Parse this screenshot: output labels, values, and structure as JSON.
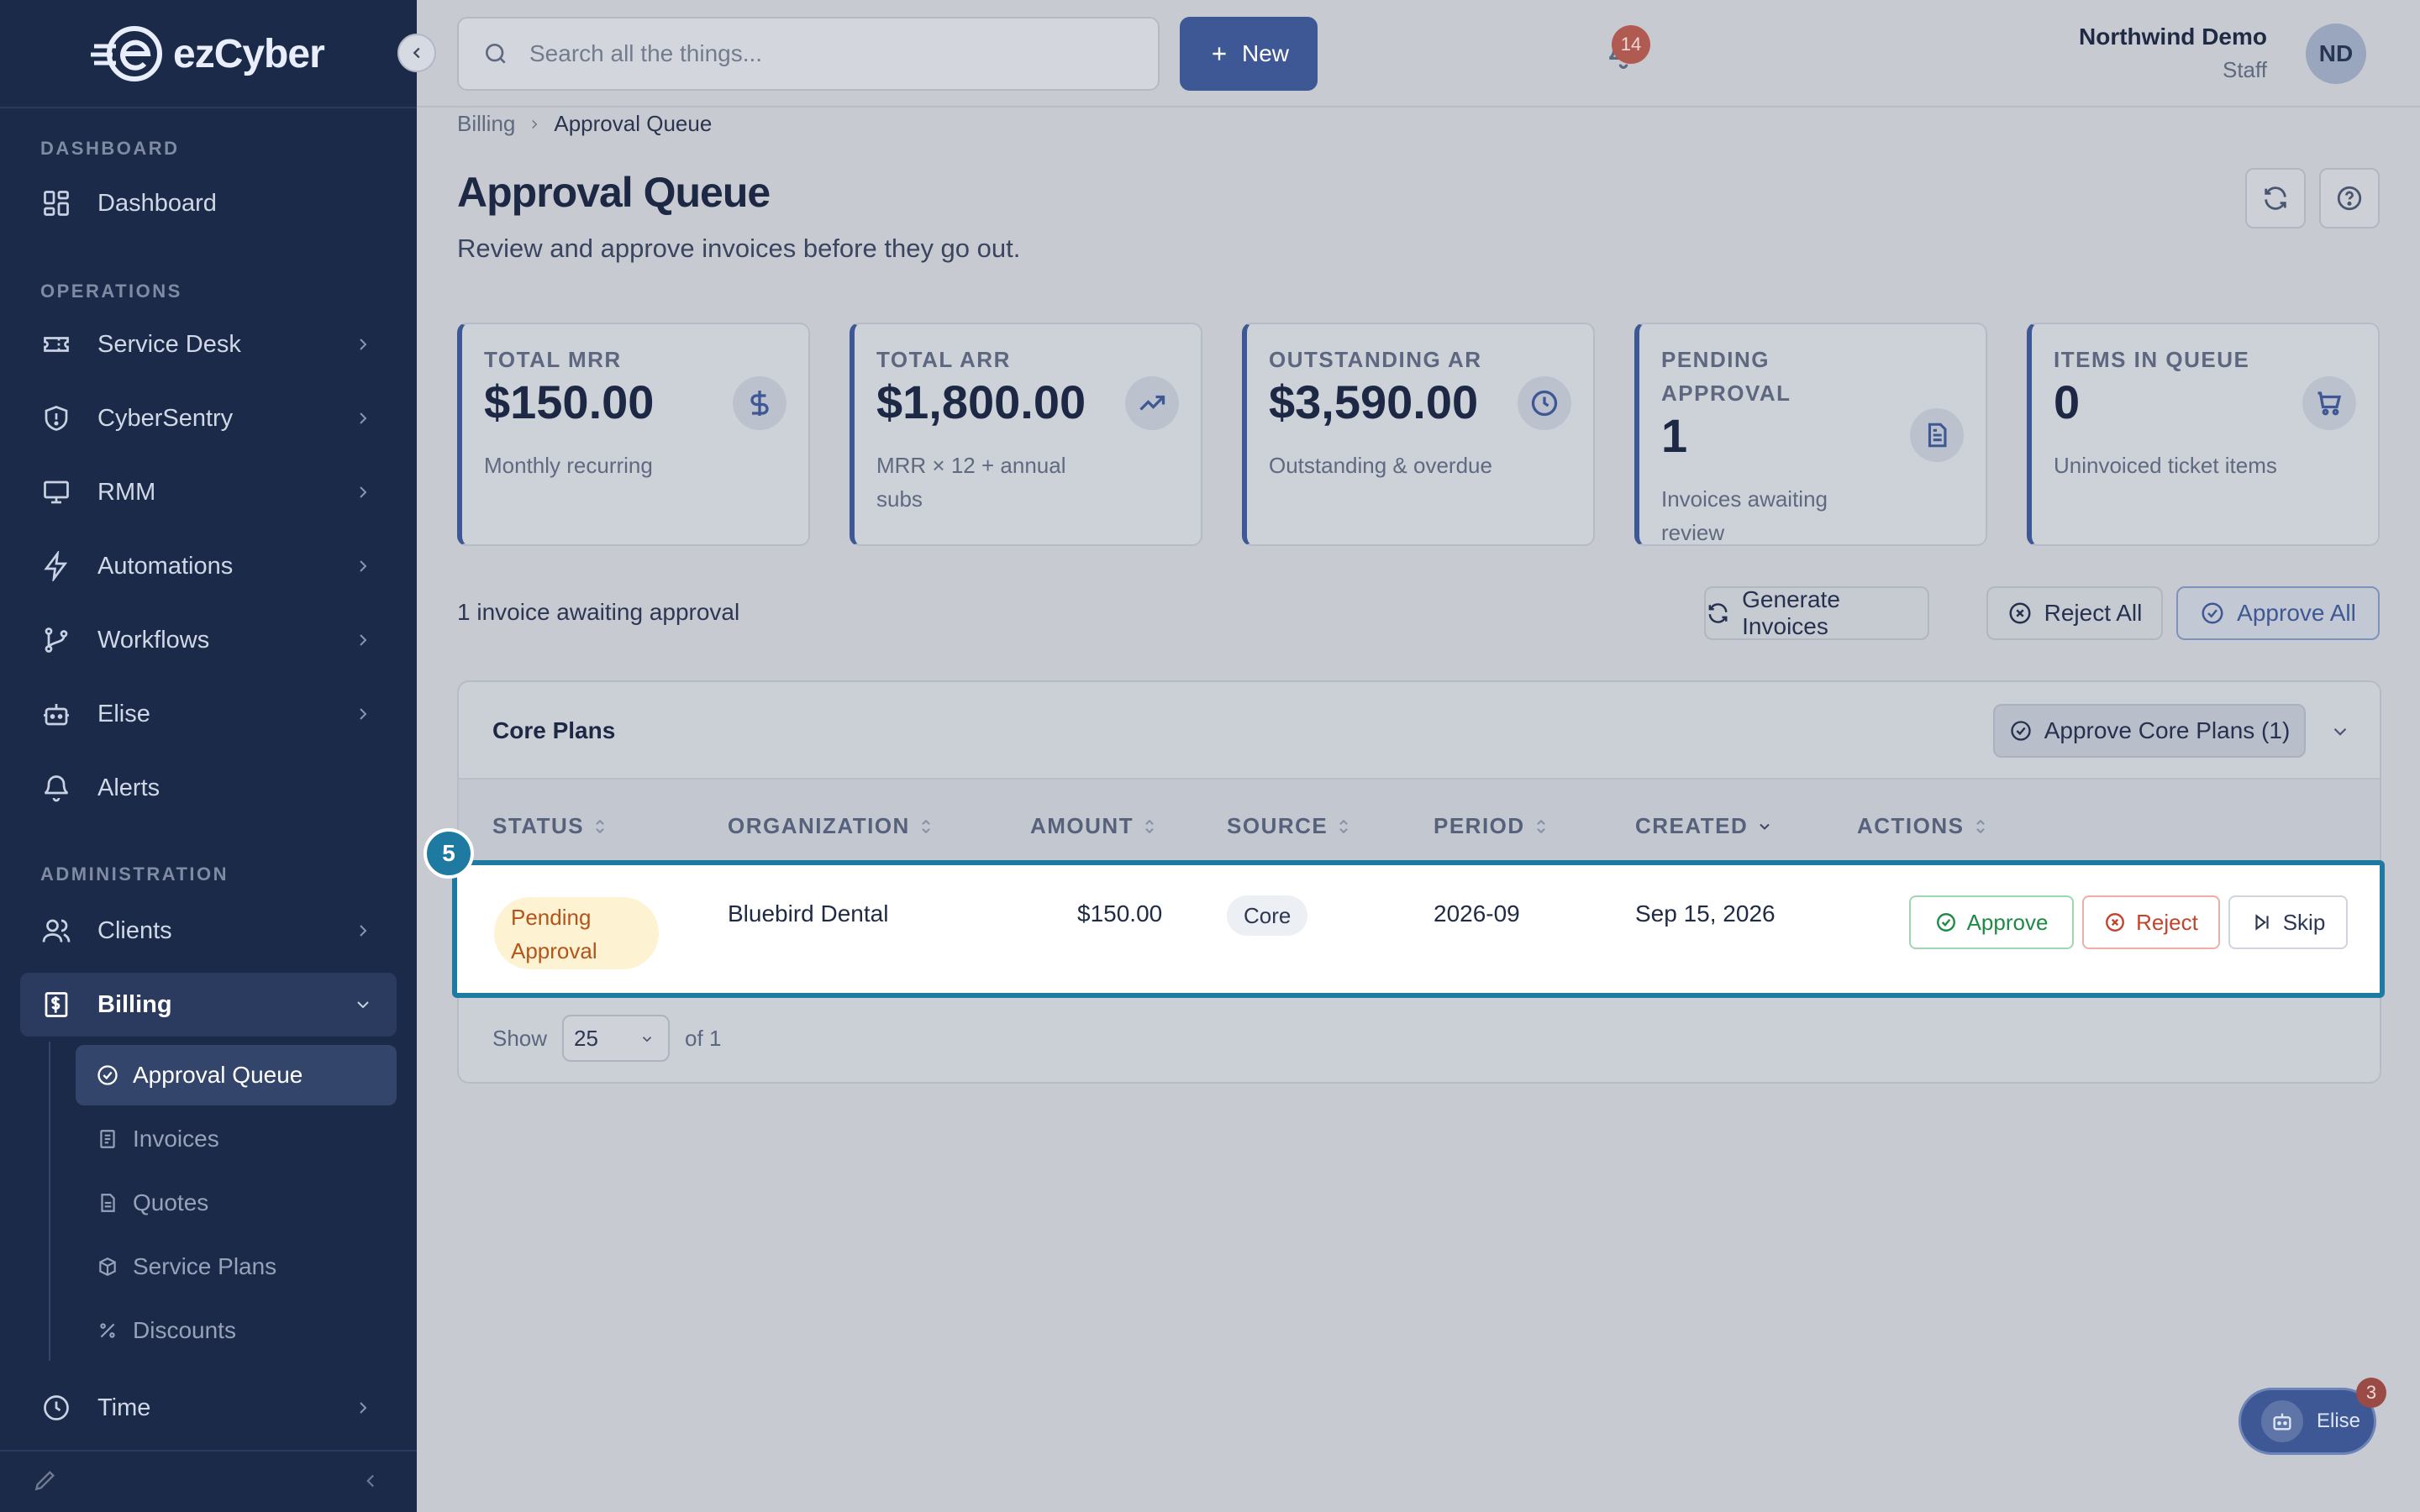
{
  "app": {
    "brand": "ezCyber"
  },
  "sidebar": {
    "sections": {
      "dashboard": "DASHBOARD",
      "operations": "OPERATIONS",
      "administration": "ADMINISTRATION"
    },
    "items": {
      "dashboard": "Dashboard",
      "service_desk": "Service Desk",
      "cybersentry": "CyberSentry",
      "rmm": "RMM",
      "automations": "Automations",
      "workflows": "Workflows",
      "elise": "Elise",
      "alerts": "Alerts",
      "clients": "Clients",
      "billing": "Billing",
      "time": "Time"
    },
    "billing_sub": {
      "approval_queue": "Approval Queue",
      "invoices": "Invoices",
      "quotes": "Quotes",
      "service_plans": "Service Plans",
      "discounts": "Discounts"
    }
  },
  "topbar": {
    "search_placeholder": "Search all the things...",
    "new_label": "New",
    "notification_count": "14",
    "user_name": "Northwind Demo",
    "user_role": "Staff",
    "avatar_initials": "ND"
  },
  "breadcrumb": {
    "parent": "Billing",
    "current": "Approval Queue"
  },
  "page": {
    "title": "Approval Queue",
    "subtitle": "Review and approve invoices before they go out."
  },
  "stats": [
    {
      "label": "TOTAL MRR",
      "value": "$150.00",
      "note": "Monthly recurring",
      "icon": "dollar-icon"
    },
    {
      "label": "TOTAL ARR",
      "value": "$1,800.00",
      "note": "MRR × 12 + annual subs",
      "icon": "trending-up-icon"
    },
    {
      "label": "OUTSTANDING AR",
      "value": "$3,590.00",
      "note": "Outstanding & overdue",
      "icon": "clock-icon"
    },
    {
      "label": "PENDING APPROVAL",
      "value": "1",
      "note": "Invoices awaiting review",
      "icon": "document-icon"
    },
    {
      "label": "ITEMS IN QUEUE",
      "value": "0",
      "note": "Uninvoiced ticket items",
      "icon": "cart-icon"
    }
  ],
  "queue": {
    "summary": "1 invoice awaiting approval",
    "generate_label": "Generate Invoices",
    "reject_all_label": "Reject All",
    "approve_all_label": "Approve All"
  },
  "panel": {
    "title": "Core Plans",
    "approve_group_label": "Approve Core Plans (1)",
    "columns": [
      "STATUS",
      "ORGANIZATION",
      "AMOUNT",
      "SOURCE",
      "PERIOD",
      "CREATED",
      "ACTIONS"
    ],
    "rows": [
      {
        "status": "Pending Approval",
        "organization": "Bluebird Dental",
        "amount": "$150.00",
        "source": "Core",
        "period": "2026-09",
        "created": "Sep 15, 2026",
        "approve": "Approve",
        "reject": "Reject",
        "skip": "Skip"
      }
    ],
    "step_number": "5",
    "pager": {
      "show_label": "Show",
      "page_size": "25",
      "of_label": "of 1"
    }
  },
  "assistant": {
    "label": "Elise",
    "badge": "3"
  },
  "colors": {
    "sidebar": "#1c2a4a",
    "accent": "#3d5894",
    "highlight": "#1e7aa0",
    "pending": "#b4541a",
    "approve": "#1f8a45",
    "reject": "#c2442c"
  }
}
